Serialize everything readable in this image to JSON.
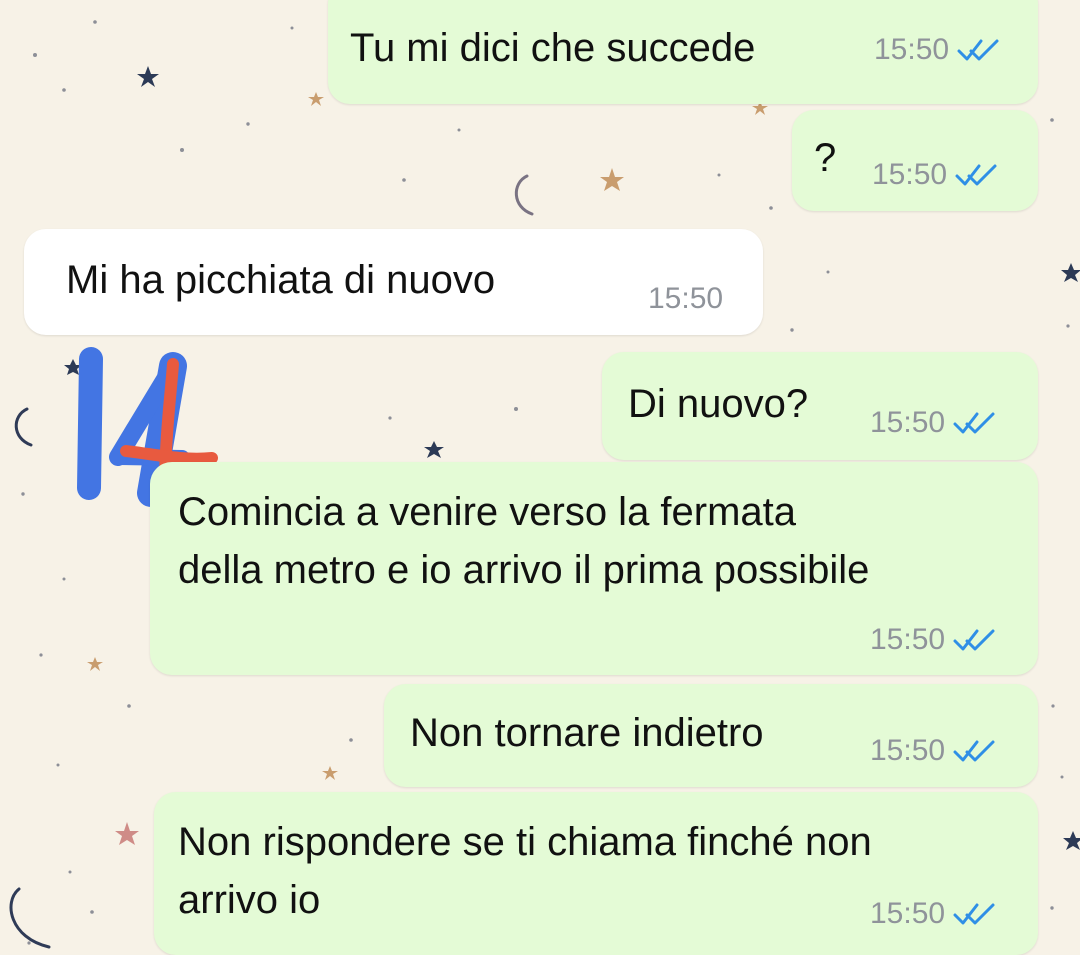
{
  "theme": {
    "background": "#f7f2e7",
    "outgoing_bubble": "#e4fbd6",
    "incoming_bubble": "#ffffff",
    "timestamp_color": "#8f939a",
    "read_tick_color": "#2f8fe6",
    "annotation_blue": "#4375e3",
    "annotation_red": "#e85a3f"
  },
  "messages": [
    {
      "direction": "outgoing",
      "text": "Tu mi dici che succede",
      "time": "15:50",
      "status_icon": "double-check-read-icon"
    },
    {
      "direction": "outgoing",
      "text": "?",
      "time": "15:50",
      "status_icon": "double-check-read-icon"
    },
    {
      "direction": "incoming",
      "text": "Mi ha picchiata di nuovo",
      "time": "15:50"
    },
    {
      "direction": "outgoing",
      "text": "Di nuovo?",
      "time": "15:50",
      "status_icon": "double-check-read-icon"
    },
    {
      "direction": "outgoing",
      "lines": [
        "Comincia a venire verso la fermata",
        "della metro e io arrivo il prima possibile"
      ],
      "time": "15:50",
      "status_icon": "double-check-read-icon"
    },
    {
      "direction": "outgoing",
      "text": "Non tornare indietro",
      "time": "15:50",
      "status_icon": "double-check-read-icon"
    },
    {
      "direction": "outgoing",
      "lines": [
        "Non rispondere se ti chiama finché non",
        "arrivo io"
      ],
      "time": "15:50",
      "status_icon": "double-check-read-icon"
    }
  ],
  "wallpaper": {
    "icons": [
      "star-icon",
      "moon-icon",
      "dot-icon"
    ]
  },
  "annotation": {
    "icon": "handwritten-14-icon"
  }
}
